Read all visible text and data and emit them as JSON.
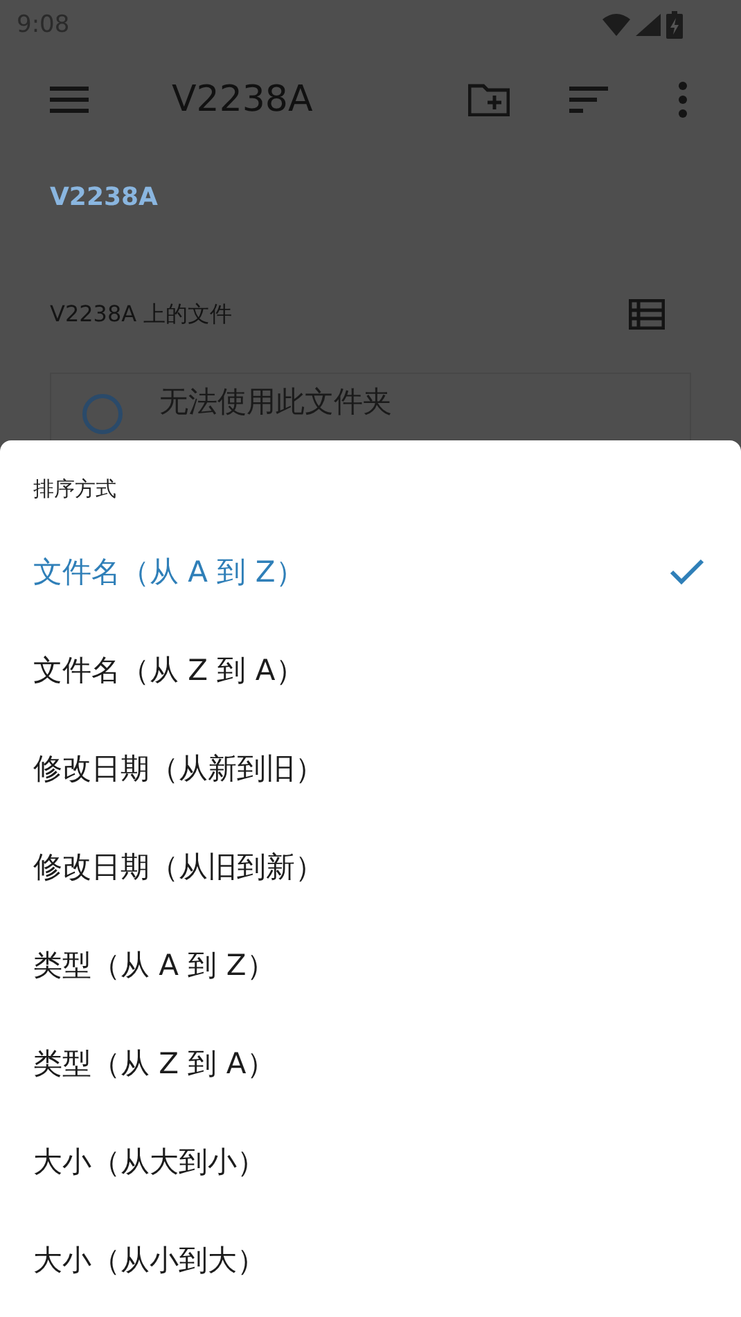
{
  "status_bar": {
    "time": "9:08"
  },
  "app_bar": {
    "title": "V2238A"
  },
  "breadcrumb": "V2238A",
  "section": {
    "title": "V2238A 上的文件"
  },
  "notice": {
    "title": "无法使用此文件夹"
  },
  "sort_sheet": {
    "title": "排序方式",
    "options": [
      {
        "label": "文件名（从 A 到 Z）",
        "selected": true
      },
      {
        "label": "文件名（从 Z 到 A）",
        "selected": false
      },
      {
        "label": "修改日期（从新到旧）",
        "selected": false
      },
      {
        "label": "修改日期（从旧到新）",
        "selected": false
      },
      {
        "label": "类型（从 A 到 Z）",
        "selected": false
      },
      {
        "label": "类型（从 Z 到 A）",
        "selected": false
      },
      {
        "label": "大小（从大到小）",
        "selected": false
      },
      {
        "label": "大小（从小到大）",
        "selected": false
      }
    ]
  }
}
